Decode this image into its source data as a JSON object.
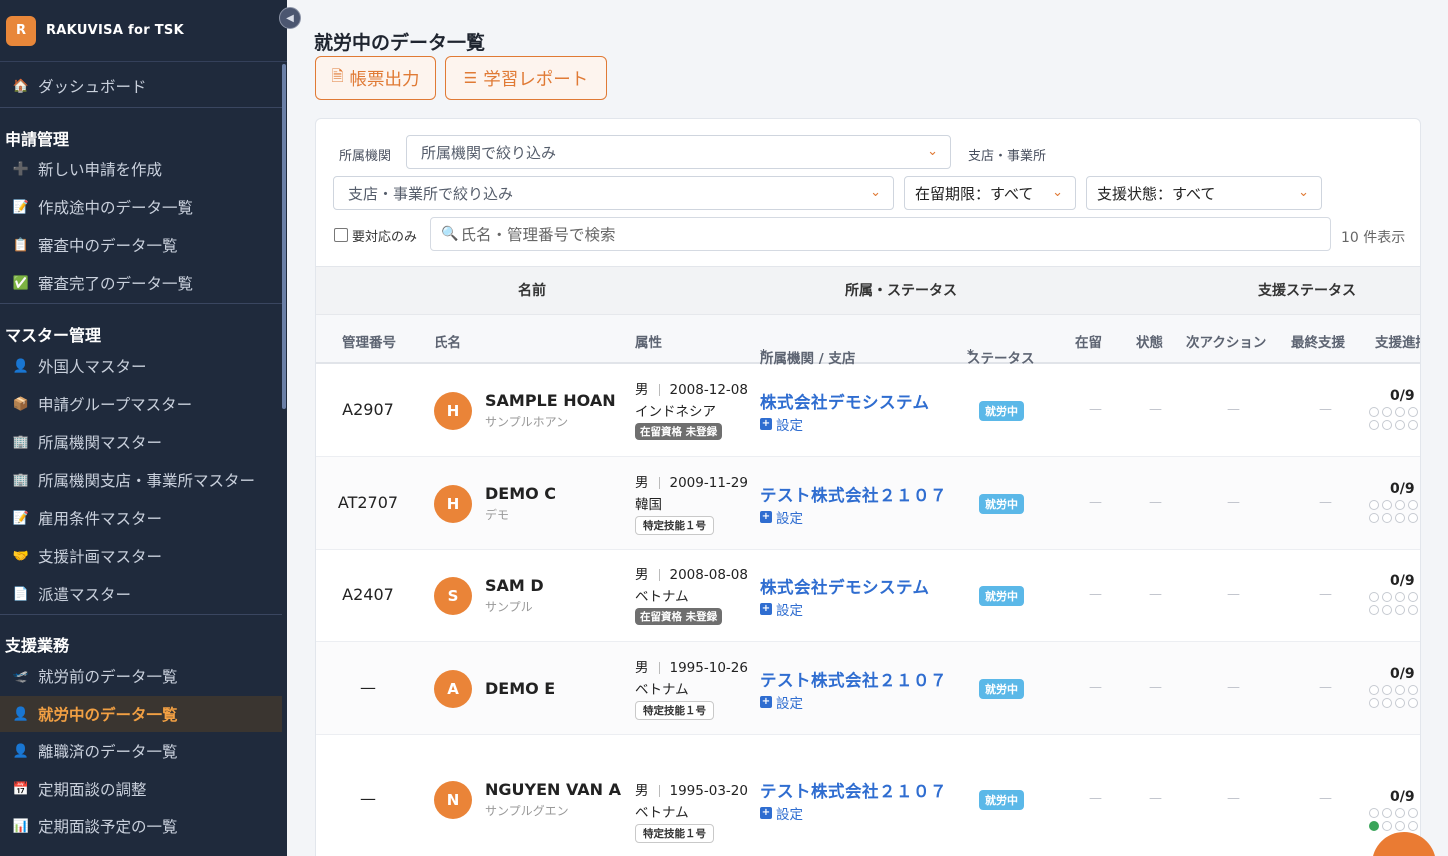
{
  "brand": {
    "logo_letter": "R",
    "name": "RAKUVISA for TSK"
  },
  "sidebar": {
    "dashboard": {
      "icon": "🏠",
      "label": "ダッシュボード"
    },
    "sections": [
      {
        "title": "申請管理",
        "items": [
          {
            "icon": "➕",
            "label": "新しい申請を作成"
          },
          {
            "icon": "📝",
            "label": "作成途中のデータ一覧"
          },
          {
            "icon": "📋",
            "label": "審査中のデータ一覧"
          },
          {
            "icon": "✅",
            "label": "審査完了のデータ一覧"
          }
        ]
      },
      {
        "title": "マスター管理",
        "items": [
          {
            "icon": "👤",
            "label": "外国人マスター"
          },
          {
            "icon": "📦",
            "label": "申請グループマスター"
          },
          {
            "icon": "🏢",
            "label": "所属機関マスター"
          },
          {
            "icon": "🏢",
            "label": "所属機関支店・事業所マスター"
          },
          {
            "icon": "📝",
            "label": "雇用条件マスター"
          },
          {
            "icon": "🤝",
            "label": "支援計画マスター"
          },
          {
            "icon": "📄",
            "label": "派遣マスター"
          }
        ]
      },
      {
        "title": "支援業務",
        "items": [
          {
            "icon": "🛫",
            "label": "就労前のデータ一覧"
          },
          {
            "icon": "👤",
            "label": "就労中のデータ一覧"
          },
          {
            "icon": "👤",
            "label": "離職済のデータ一覧"
          },
          {
            "icon": "📅",
            "label": "定期面談の調整"
          },
          {
            "icon": "📊",
            "label": "定期面談予定の一覧"
          }
        ]
      }
    ],
    "active_item": "就労中のデータ一覧"
  },
  "page": {
    "title": "就労中のデータ一覧",
    "btn_report": "帳票出力",
    "btn_learning": "学習レポート"
  },
  "filters": {
    "org_label": "所属機関",
    "org_placeholder": "所属機関で絞り込み",
    "branch_label": "支店・事業所",
    "branch_placeholder": "支店・事業所で絞り込み",
    "stay_period": "在留期限：すべて",
    "support_state": "支援状態：すべて",
    "needs_action_label": "要対応のみ",
    "search_placeholder": "氏名・管理番号で検索",
    "count_text": "10 件表示"
  },
  "table": {
    "group_headers": {
      "name": "名前",
      "org_status": "所属・ステータス",
      "support_status": "支援ステータス"
    },
    "columns": {
      "mgmt_no": "管理番号",
      "name": "氏名",
      "attr": "属性",
      "org": "所属機関 / 支店",
      "status": "ステータス",
      "stay": "在留",
      "state": "状態",
      "next_action": "次アクション",
      "last_support": "最終支援",
      "progress": "支援進捗"
    },
    "required_mark": "*",
    "setting_label": "設定",
    "dash": "—",
    "rows": [
      {
        "mgmt_no": "A2907",
        "initial": "H",
        "name": "SAMPLE HOAN",
        "kana": "サンプルホアン",
        "gender": "男",
        "dob": "2008-12-08",
        "nationality": "インドネシア",
        "visa_badge": "在留資格 未登録",
        "visa_dark": true,
        "org": "株式会社デモシステム",
        "status": "就労中",
        "progress": "0/9",
        "progress_done": 0
      },
      {
        "mgmt_no": "AT2707",
        "initial": "H",
        "name": "DEMO C",
        "kana": "デモ",
        "gender": "男",
        "dob": "2009-11-29",
        "nationality": "韓国",
        "visa_badge": "特定技能１号",
        "visa_dark": false,
        "org": "テスト株式会社２１０７",
        "status": "就労中",
        "progress": "0/9",
        "progress_done": 0
      },
      {
        "mgmt_no": "A2407",
        "initial": "S",
        "name": "SAM D",
        "kana": "サンプル",
        "gender": "男",
        "dob": "2008-08-08",
        "nationality": "ベトナム",
        "visa_badge": "在留資格 未登録",
        "visa_dark": true,
        "org": "株式会社デモシステム",
        "status": "就労中",
        "progress": "0/9",
        "progress_done": 0
      },
      {
        "mgmt_no": "—",
        "initial": "A",
        "name": "DEMO E",
        "kana": "",
        "gender": "男",
        "dob": "1995-10-26",
        "nationality": "ベトナム",
        "visa_badge": "特定技能１号",
        "visa_dark": false,
        "org": "テスト株式会社２１０７",
        "status": "就労中",
        "progress": "0/9",
        "progress_done": 0
      },
      {
        "mgmt_no": "—",
        "initial": "N",
        "name": "NGUYEN VAN A",
        "kana": "サンプルグエン",
        "gender": "男",
        "dob": "1995-03-20",
        "nationality": "ベトナム",
        "visa_badge": "特定技能１号",
        "visa_dark": false,
        "org": "テスト株式会社２１０７",
        "status": "就労中",
        "progress": "0/9",
        "progress_done": 1
      }
    ]
  },
  "colors": {
    "accent": "#e07a35",
    "sidebar_bg": "#1f2a3c",
    "link": "#2f6dd0",
    "status_badge": "#5bb8e8"
  }
}
